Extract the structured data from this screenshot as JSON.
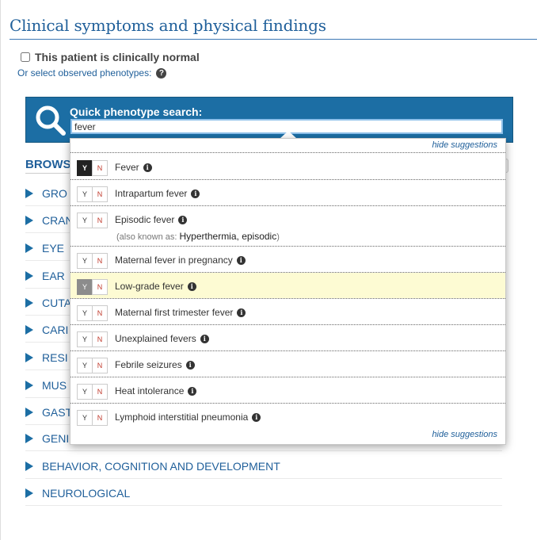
{
  "section_title": "Clinical symptoms and physical findings",
  "normal_checkbox_label": "This patient is clinically normal",
  "or_select_text": "Or select observed phenotypes:",
  "search": {
    "label": "Quick phenotype search:",
    "value": "fever"
  },
  "hide_suggestions": "hide suggestions",
  "browse_heading": "BROWS",
  "categories": [
    "GRO",
    "CRAN",
    "EYE",
    "EAR",
    "CUTA",
    "CARI",
    "RESI",
    "MUS",
    "GAST",
    "GENI",
    "BEHAVIOR, COGNITION AND DEVELOPMENT",
    "NEUROLOGICAL"
  ],
  "suggestions": [
    {
      "label": "Fever",
      "y": "Y",
      "n": "N",
      "selected": "yes"
    },
    {
      "label": "Intrapartum fever",
      "y": "Y",
      "n": "N"
    },
    {
      "label": "Episodic fever",
      "y": "Y",
      "n": "N",
      "aka_prefix": "(also known as:",
      "aka_value": "Hyperthermia, episodic",
      "aka_suffix": ")"
    },
    {
      "label": "Maternal fever in pregnancy",
      "y": "Y",
      "n": "N"
    },
    {
      "label": "Low-grade fever",
      "y": "Y",
      "n": "N",
      "highlighted": true
    },
    {
      "label": "Maternal first trimester fever",
      "y": "Y",
      "n": "N"
    },
    {
      "label": "Unexplained fevers",
      "y": "Y",
      "n": "N"
    },
    {
      "label": "Febrile seizures",
      "y": "Y",
      "n": "N"
    },
    {
      "label": "Heat intolerance",
      "y": "Y",
      "n": "N"
    },
    {
      "label": "Lymphoid interstitial pneumonia",
      "y": "Y",
      "n": "N"
    }
  ],
  "colors": {
    "accent": "#1c6ea4",
    "heading": "#1f5f9a",
    "highlight": "#fdfbd3",
    "no": "#c0392b"
  },
  "icons": [
    "search-icon",
    "help-icon",
    "info-icon",
    "expand-triangle-icon"
  ]
}
